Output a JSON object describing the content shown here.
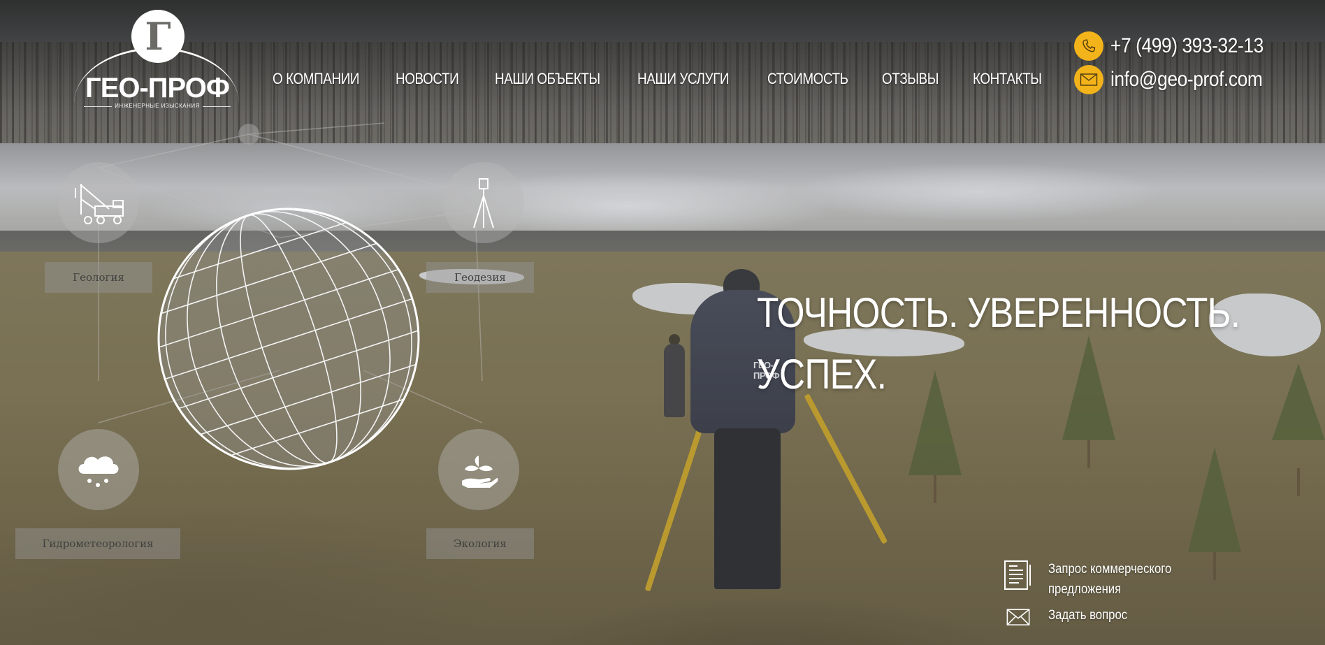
{
  "brand": {
    "name": "ГЕО-ПРОФ",
    "tagline": "ИНЖЕНЕРНЫЕ ИЗЫСКАНИЯ"
  },
  "nav": {
    "items": [
      {
        "label": "О КОМПАНИИ"
      },
      {
        "label": "НОВОСТИ"
      },
      {
        "label": "НАШИ ОБЪЕКТЫ"
      },
      {
        "label": "НАШИ УСЛУГИ"
      },
      {
        "label": "СТОИМОСТЬ"
      },
      {
        "label": "ОТЗЫВЫ"
      },
      {
        "label": "КОНТАКТЫ"
      }
    ]
  },
  "contacts": {
    "phone": "+7 (499) 393-32-13",
    "email": "info@geo-prof.com",
    "icon_color": "#f3b31a"
  },
  "services": [
    {
      "label": "Геология",
      "icon": "crane-truck-icon"
    },
    {
      "label": "Геодезия",
      "icon": "theodolite-icon"
    },
    {
      "label": "Гидрометеорология",
      "icon": "rain-cloud-icon"
    },
    {
      "label": "Экология",
      "icon": "plant-in-hand-icon"
    }
  ],
  "hero": {
    "line1": "ТОЧНОСТЬ. УВЕРЕННОСТЬ.",
    "line2": "УСПЕХ."
  },
  "actions": {
    "quote_label": "Запрос коммерческого предложения",
    "ask_label": "Задать вопрос"
  }
}
